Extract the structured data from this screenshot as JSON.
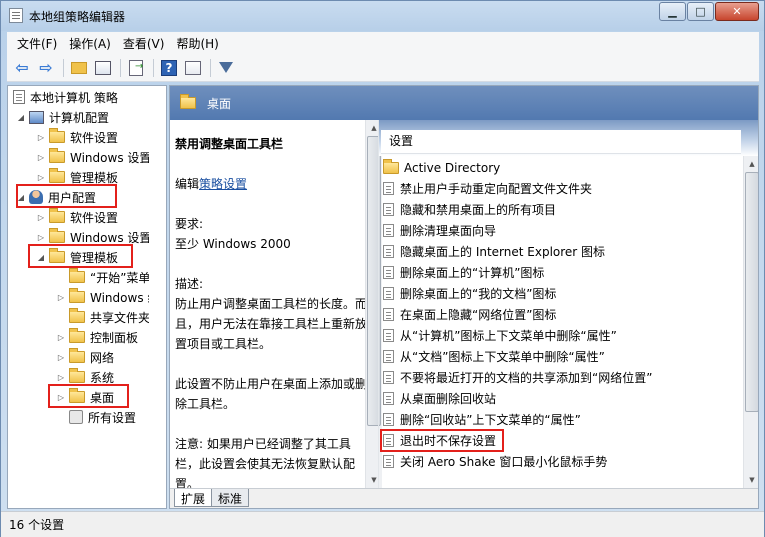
{
  "window": {
    "title": "本地组策略编辑器",
    "minimize_icon": "minimize-icon",
    "maximize_icon": "maximize-icon",
    "close_icon": "close-icon"
  },
  "menubar": {
    "items": [
      {
        "label": "文件(F)"
      },
      {
        "label": "操作(A)"
      },
      {
        "label": "查看(V)"
      },
      {
        "label": "帮助(H)"
      }
    ]
  },
  "toolbar": {
    "icons": [
      "back-icon",
      "forward-icon",
      "up-folder-icon",
      "show-hide-tree-icon",
      "export-list-icon",
      "help-icon",
      "properties-icon",
      "filter-icon"
    ]
  },
  "tree": {
    "root": "本地计算机 策略",
    "computer_config": "计算机配置",
    "cc_software": "软件设置",
    "cc_windows": "Windows 设置",
    "cc_admin": "管理模板",
    "user_config": "用户配置",
    "uc_software": "软件设置",
    "uc_windows": "Windows 设置",
    "uc_admin": "管理模板",
    "start_menu": "“开始”菜单",
    "windows_components": "Windows 组",
    "shared_folders": "共享文件夹",
    "control_panel": "控制面板",
    "network": "网络",
    "system": "系统",
    "desktop": "桌面",
    "all_settings": "所有设置"
  },
  "center": {
    "header_title": "桌面",
    "desc": {
      "title": "禁用调整桌面工具栏",
      "edit_prefix": "编辑",
      "edit_link": "策略设置",
      "req_label": "要求:",
      "req_value": "至少 Windows 2000",
      "desc_label": "描述:",
      "desc_text": "防止用户调整桌面工具栏的长度。而且，用户无法在靠接工具栏上重新放置项目或工具栏。",
      "note1": "此设置不防止用户在桌面上添加或删除工具栏。",
      "note2": "注意: 如果用户已经调整了其工具栏，此设置会使其无法恢复默认配置。"
    },
    "settings_header": "设置",
    "settings": [
      {
        "label": "Active Directory",
        "type": "folder"
      },
      {
        "label": "禁止用户手动重定向配置文件文件夹",
        "type": "setting"
      },
      {
        "label": "隐藏和禁用桌面上的所有项目",
        "type": "setting"
      },
      {
        "label": "删除清理桌面向导",
        "type": "setting"
      },
      {
        "label": "隐藏桌面上的 Internet Explorer 图标",
        "type": "setting"
      },
      {
        "label": "删除桌面上的“计算机”图标",
        "type": "setting"
      },
      {
        "label": "删除桌面上的“我的文档”图标",
        "type": "setting"
      },
      {
        "label": "在桌面上隐藏“网络位置”图标",
        "type": "setting"
      },
      {
        "label": "从“计算机”图标上下文菜单中删除“属性”",
        "type": "setting"
      },
      {
        "label": "从“文档”图标上下文菜单中删除“属性”",
        "type": "setting"
      },
      {
        "label": "不要将最近打开的文档的共享添加到“网络位置”",
        "type": "setting"
      },
      {
        "label": "从桌面删除回收站",
        "type": "setting"
      },
      {
        "label": "删除“回收站”上下文菜单的“属性”",
        "type": "setting"
      },
      {
        "label": "退出时不保存设置",
        "type": "setting"
      },
      {
        "label": "关闭 Aero Shake 窗口最小化鼠标手势",
        "type": "setting"
      }
    ],
    "tabs": [
      {
        "label": "扩展"
      },
      {
        "label": "标准"
      }
    ]
  },
  "status": {
    "text": "16 个设置"
  },
  "colors": {
    "highlight": "#e3201b",
    "header_blue": "#5279b0",
    "link": "#1a4fa0"
  }
}
